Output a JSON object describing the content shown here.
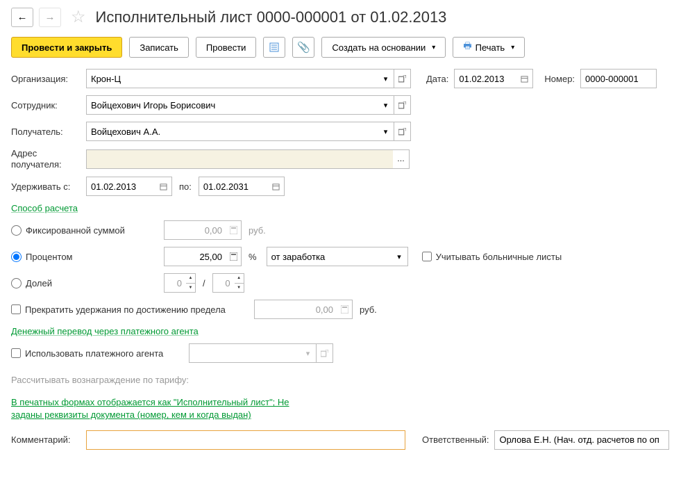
{
  "header": {
    "title": "Исполнительный лист 0000-000001 от 01.02.2013"
  },
  "toolbar": {
    "post_close": "Провести и закрыть",
    "write": "Записать",
    "post": "Провести",
    "create_based": "Создать на основании",
    "print": "Печать"
  },
  "form": {
    "organization_label": "Организация:",
    "organization": "Крон-Ц",
    "date_label": "Дата:",
    "date": "01.02.2013",
    "number_label": "Номер:",
    "number": "0000-000001",
    "employee_label": "Сотрудник:",
    "employee": "Войцехович Игорь Борисович",
    "recipient_label": "Получатель:",
    "recipient": "Войцехович А.А.",
    "address_label": "Адрес получателя:",
    "address": "",
    "withhold_from_label": "Удерживать с:",
    "withhold_from": "01.02.2013",
    "withhold_to_label": "по:",
    "withhold_to": "01.02.2031"
  },
  "calc": {
    "section": "Способ расчета",
    "fixed_label": "Фиксированной суммой",
    "fixed_value": "0,00",
    "fixed_unit": "руб.",
    "percent_label": "Процентом",
    "percent_value": "25,00",
    "percent_unit": "%",
    "percent_base": "от заработка",
    "sick_leave": "Учитывать больничные листы",
    "fraction_label": "Долей",
    "fraction_num": "0",
    "fraction_div": "/",
    "fraction_den": "0",
    "stop_limit_label": "Прекратить удержания по достижению предела",
    "stop_limit_value": "0,00",
    "stop_limit_unit": "руб."
  },
  "transfer": {
    "section": "Денежный перевод через платежного агента",
    "use_agent": "Использовать платежного агента",
    "tariff_label": "Рассчитывать вознаграждение по тарифу:"
  },
  "footer": {
    "link1": "В печатных формах отображается как \"Исполнительный лист\"; Не",
    "link2": "заданы реквизиты документа (номер, кем и когда выдан)",
    "comment_label": "Комментарий:",
    "comment": "",
    "responsible_label": "Ответственный:",
    "responsible": "Орлова Е.Н. (Нач. отд. расчетов по оп"
  }
}
